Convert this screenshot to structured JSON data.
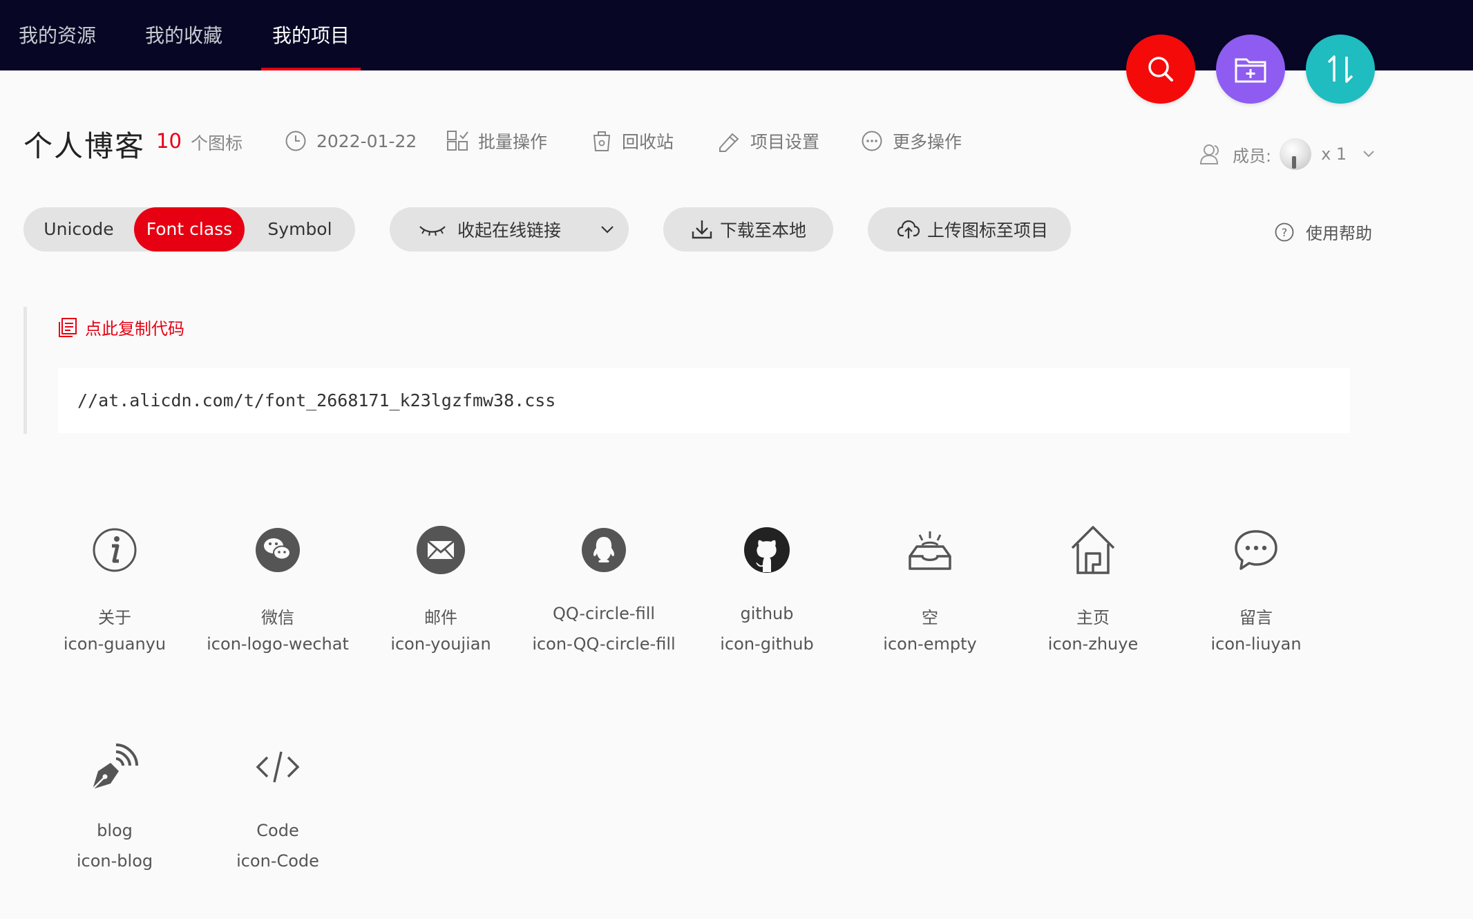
{
  "nav": {
    "tabs": [
      {
        "label": "我的资源"
      },
      {
        "label": "我的收藏"
      },
      {
        "label": "我的项目",
        "active": true
      }
    ]
  },
  "fabs": {
    "search": {
      "icon": "search-icon",
      "color": "#f50a0a"
    },
    "add_project": {
      "icon": "folder-add-icon",
      "color": "#8e5cf0"
    },
    "sort": {
      "icon": "sort-icon",
      "color": "#1fbcc0"
    }
  },
  "project": {
    "title": "个人博客",
    "icon_count": "10",
    "icon_count_label": "个图标",
    "date": "2022-01-22",
    "actions": {
      "batch": "批量操作",
      "recycle": "回收站",
      "settings": "项目设置",
      "more": "更多操作"
    },
    "members_label": "成员:",
    "members_count": "x 1"
  },
  "toolbar": {
    "modes": [
      {
        "label": "Unicode"
      },
      {
        "label": "Font class",
        "active": true
      },
      {
        "label": "Symbol"
      }
    ],
    "collapse_link": "收起在线链接",
    "download": "下载至本地",
    "upload": "上传图标至项目",
    "help": "使用帮助"
  },
  "code": {
    "copy_label": "点此复制代码",
    "url": "//at.alicdn.com/t/font_2668171_k23lgzfmw38.css"
  },
  "icons": [
    {
      "name": "关于",
      "class": "icon-guanyu",
      "glyph": "info-icon"
    },
    {
      "name": "微信",
      "class": "icon-logo-wechat",
      "glyph": "wechat-icon"
    },
    {
      "name": "邮件",
      "class": "icon-youjian",
      "glyph": "mail-icon"
    },
    {
      "name": "QQ-circle-fill",
      "class": "icon-QQ-circle-fill",
      "glyph": "qq-icon"
    },
    {
      "name": "github",
      "class": "icon-github",
      "glyph": "github-icon"
    },
    {
      "name": "空",
      "class": "icon-empty",
      "glyph": "empty-tray-icon"
    },
    {
      "name": "主页",
      "class": "icon-zhuye",
      "glyph": "home-icon"
    },
    {
      "name": "留言",
      "class": "icon-liuyan",
      "glyph": "message-icon"
    },
    {
      "name": "blog",
      "class": "icon-blog",
      "glyph": "pen-icon"
    },
    {
      "name": "Code",
      "class": "icon-Code",
      "glyph": "code-icon"
    }
  ],
  "colors": {
    "topbar": "#070725",
    "accent": "#e60012",
    "pill_bg": "#e3e3e3",
    "icon_gray": "#555555"
  }
}
